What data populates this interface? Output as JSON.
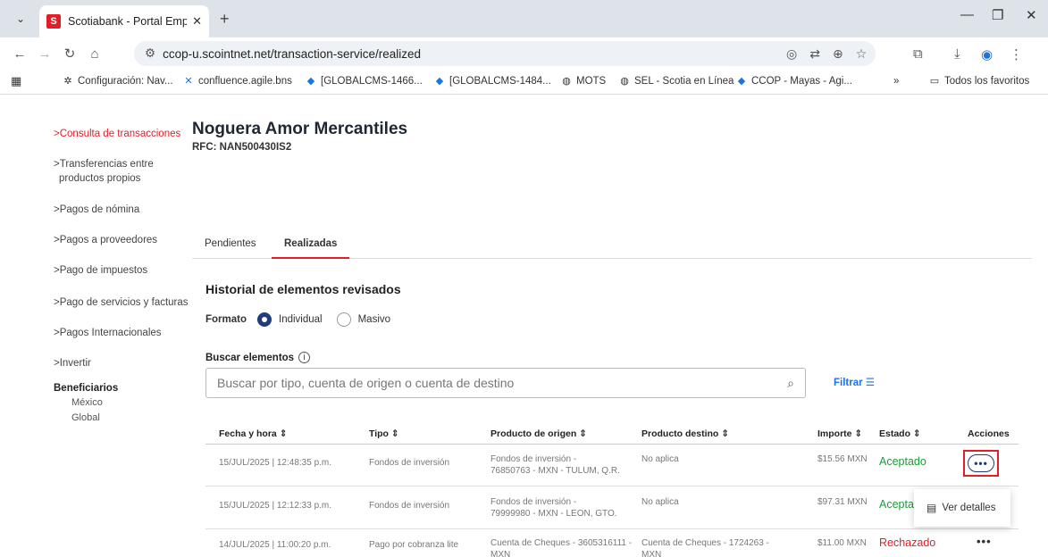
{
  "browser": {
    "tab_title": "Scotiabank - Portal Empresas",
    "favicon_letter": "S",
    "url": "ccop-u.scointnet.net/transaction-service/realized",
    "bookmarks": [
      {
        "label": "Configuración: Nav...",
        "icon": "gear-icon"
      },
      {
        "label": "confluence.agile.bns",
        "icon": "confluence-icon"
      },
      {
        "label": "[GLOBALCMS-1466...",
        "icon": "jira-diamond-icon"
      },
      {
        "label": "[GLOBALCMS-1484...",
        "icon": "jira-diamond-icon"
      },
      {
        "label": "MOTS",
        "icon": "globe-icon"
      },
      {
        "label": "SEL - Scotia en Línea",
        "icon": "globe-icon"
      },
      {
        "label": "CCOP - Mayas - Agi...",
        "icon": "jira-diamond-icon"
      }
    ],
    "more_bookmarks": "»",
    "all_bookmarks": "Todos los favoritos"
  },
  "sidebar": {
    "items": [
      {
        "label": "Consulta de transacciones",
        "prefix": ">"
      },
      {
        "label": "Transferencias entre",
        "label2": "productos propios",
        "prefix": ">"
      },
      {
        "label": "Pagos de nómina",
        "prefix": ">"
      },
      {
        "label": "Pagos a proveedores",
        "prefix": ">"
      },
      {
        "label": "Pago de impuestos",
        "prefix": ">"
      },
      {
        "label": "Pago de servicios y facturas",
        "prefix": ">"
      },
      {
        "label": "Pagos Internacionales",
        "prefix": ">"
      },
      {
        "label": "Invertir",
        "prefix": ">"
      }
    ],
    "beneficiarios": "Beneficiarios",
    "sub": [
      "México",
      "Global"
    ]
  },
  "header": {
    "company": "Noguera Amor Mercantiles",
    "rfc": "RFC: NAN500430IS2"
  },
  "tabs": [
    "Pendientes",
    "Realizadas"
  ],
  "history_title": "Historial de elementos revisados",
  "formato": {
    "label": "Formato",
    "options": [
      "Individual",
      "Masivo"
    ],
    "selected": "Individual"
  },
  "search": {
    "label": "Buscar elementos",
    "placeholder": "Buscar por tipo, cuenta de origen o cuenta de destino",
    "filter_label": "Filtrar"
  },
  "table": {
    "headers": [
      "Fecha y hora ⇕",
      "Tipo ⇕",
      "Producto de origen ⇕",
      "Producto destino ⇕",
      "Importe ⇕",
      "Estado ⇕",
      "Acciones"
    ],
    "rows": [
      {
        "fecha": "15/JUL/2025 | 12:48:35 p.m.",
        "tipo": "Fondos de inversión",
        "origen1": "Fondos de inversión -",
        "origen2": "76850763 - MXN - TULUM, Q.R.",
        "destino1": "No aplica",
        "destino2": "",
        "importe": "$15.56 MXN",
        "estado": "Aceptado"
      },
      {
        "fecha": "15/JUL/2025 | 12:12:33 p.m.",
        "tipo": "Fondos de inversión",
        "origen1": "Fondos de inversión -",
        "origen2": "79999980 - MXN - LEON, GTO.",
        "destino1": "No aplica",
        "destino2": "",
        "importe": "$97.31 MXN",
        "estado": "Acepta"
      },
      {
        "fecha": "14/JUL/2025 | 11:00:20 p.m.",
        "tipo": "Pago por cobranza lite",
        "origen1": "Cuenta de Cheques - 3605316111 -",
        "origen2": "MXN",
        "destino1": "Cuenta de Cheques - 1724263 -",
        "destino2": "MXN",
        "importe": "$11.00 MXN",
        "estado": "Rechazado"
      }
    ]
  },
  "popup": {
    "label": "Ver detalles"
  },
  "colors": {
    "accent": "#e01f26",
    "navy": "#1f3d78",
    "ok": "#1e9b3a",
    "link": "#1a73e8"
  }
}
